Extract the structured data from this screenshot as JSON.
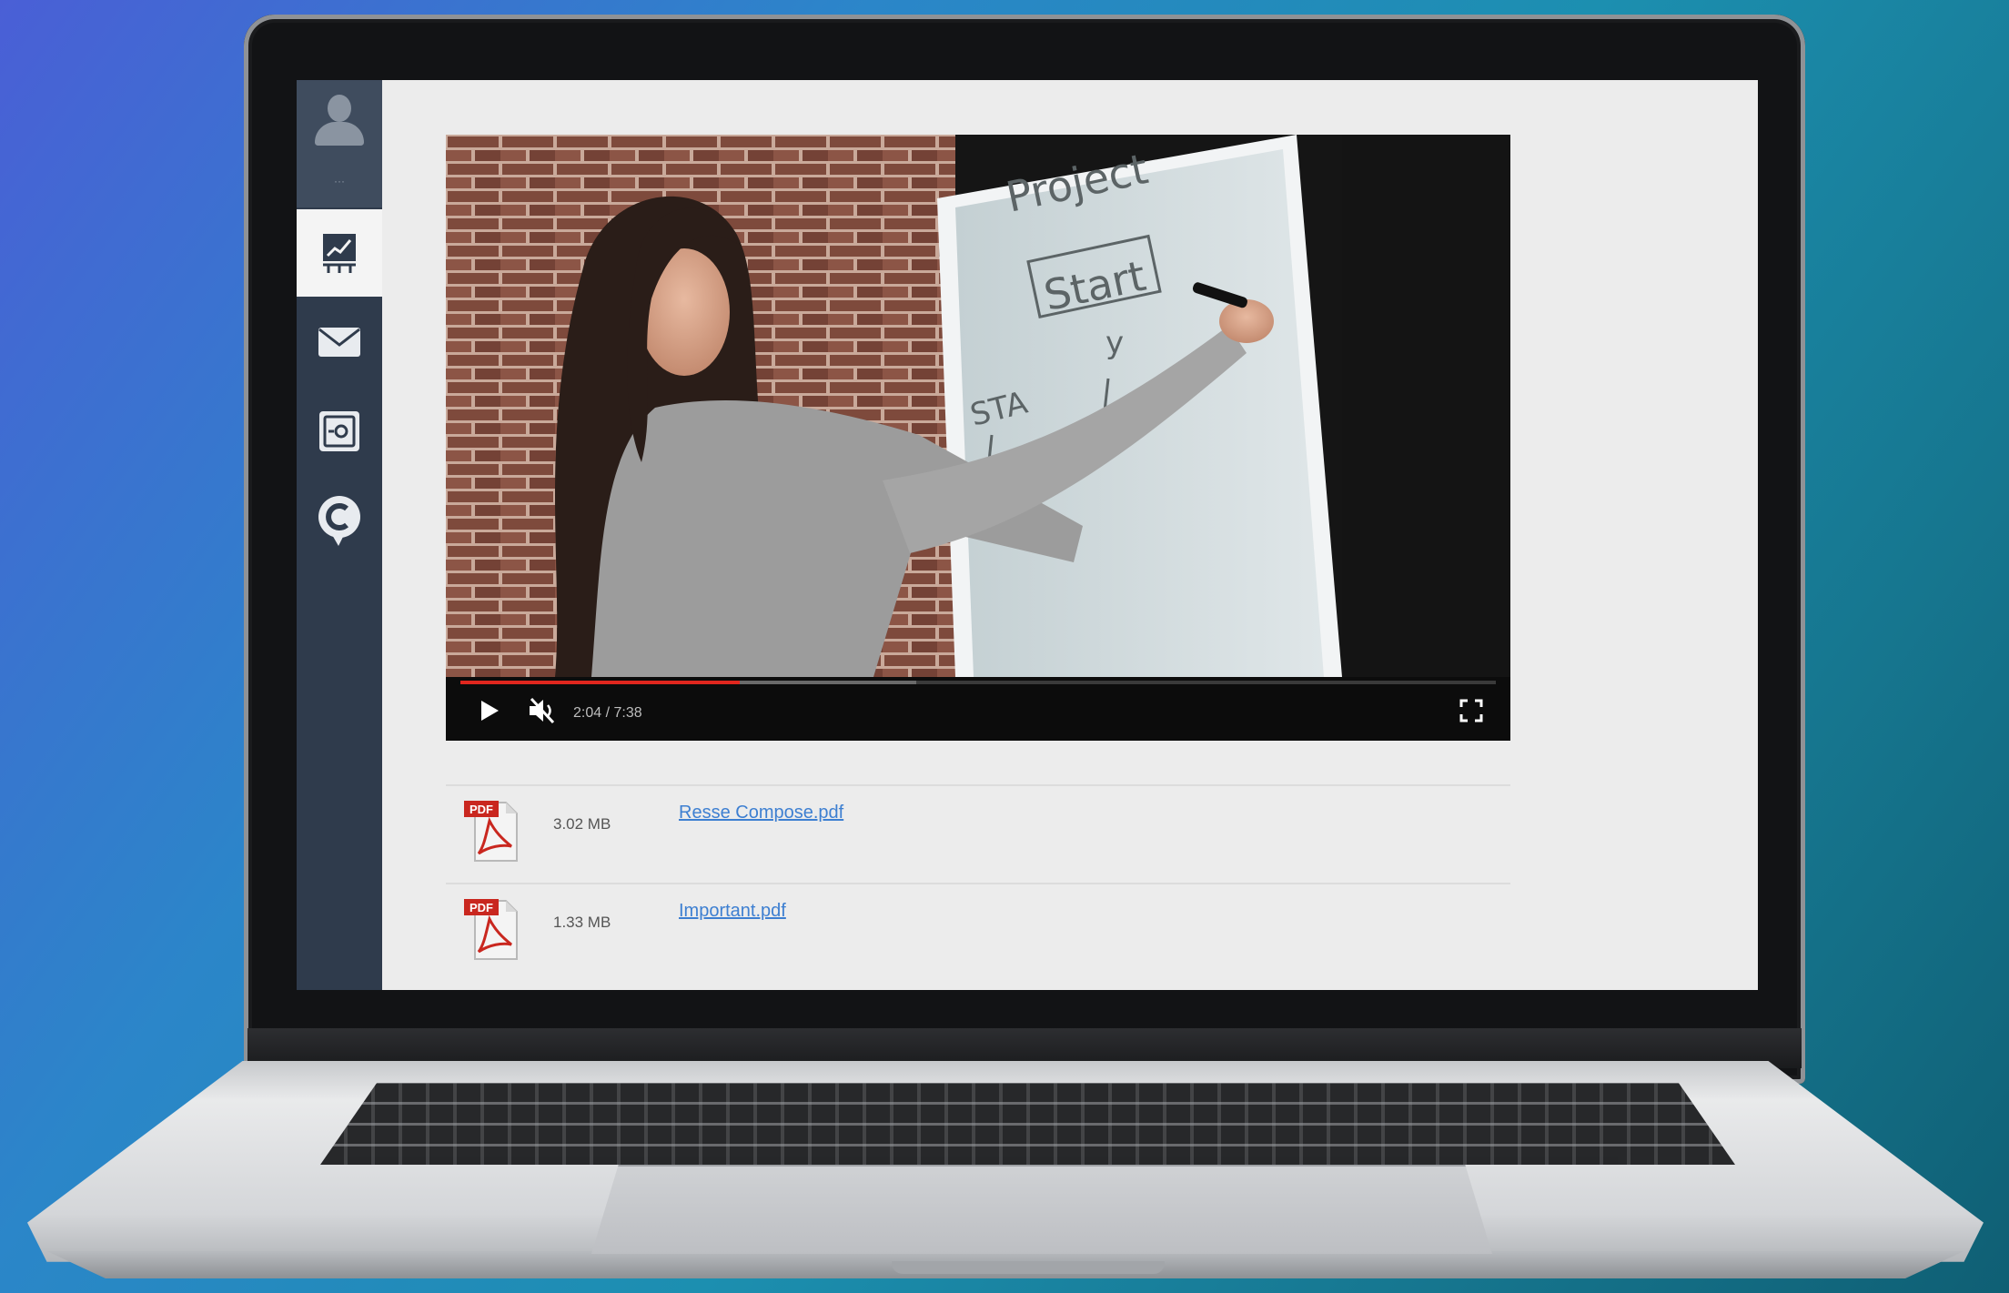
{
  "sidebar": {
    "avatar_label": "···",
    "items": [
      {
        "icon": "presentation-chart-icon",
        "active": true
      },
      {
        "icon": "envelope-icon",
        "active": false
      },
      {
        "icon": "safe-icon",
        "active": false
      },
      {
        "icon": "chat-c-icon",
        "active": false
      }
    ]
  },
  "player": {
    "time": "2:04 / 7:38",
    "progress": 0.27,
    "buffered": 0.44,
    "whiteboard_text": [
      "Project",
      "Start",
      "STA",
      "V",
      "y"
    ]
  },
  "files": [
    {
      "size": "3.02 MB",
      "name": "Resse Compose.pdf",
      "icon_label": "PDF"
    },
    {
      "size": "1.33 MB",
      "name": "Important.pdf",
      "icon_label": "PDF"
    }
  ],
  "colors": {
    "sidebar": "#2f3b4c",
    "progress": "#e0261e",
    "link": "#3d7fd1"
  }
}
